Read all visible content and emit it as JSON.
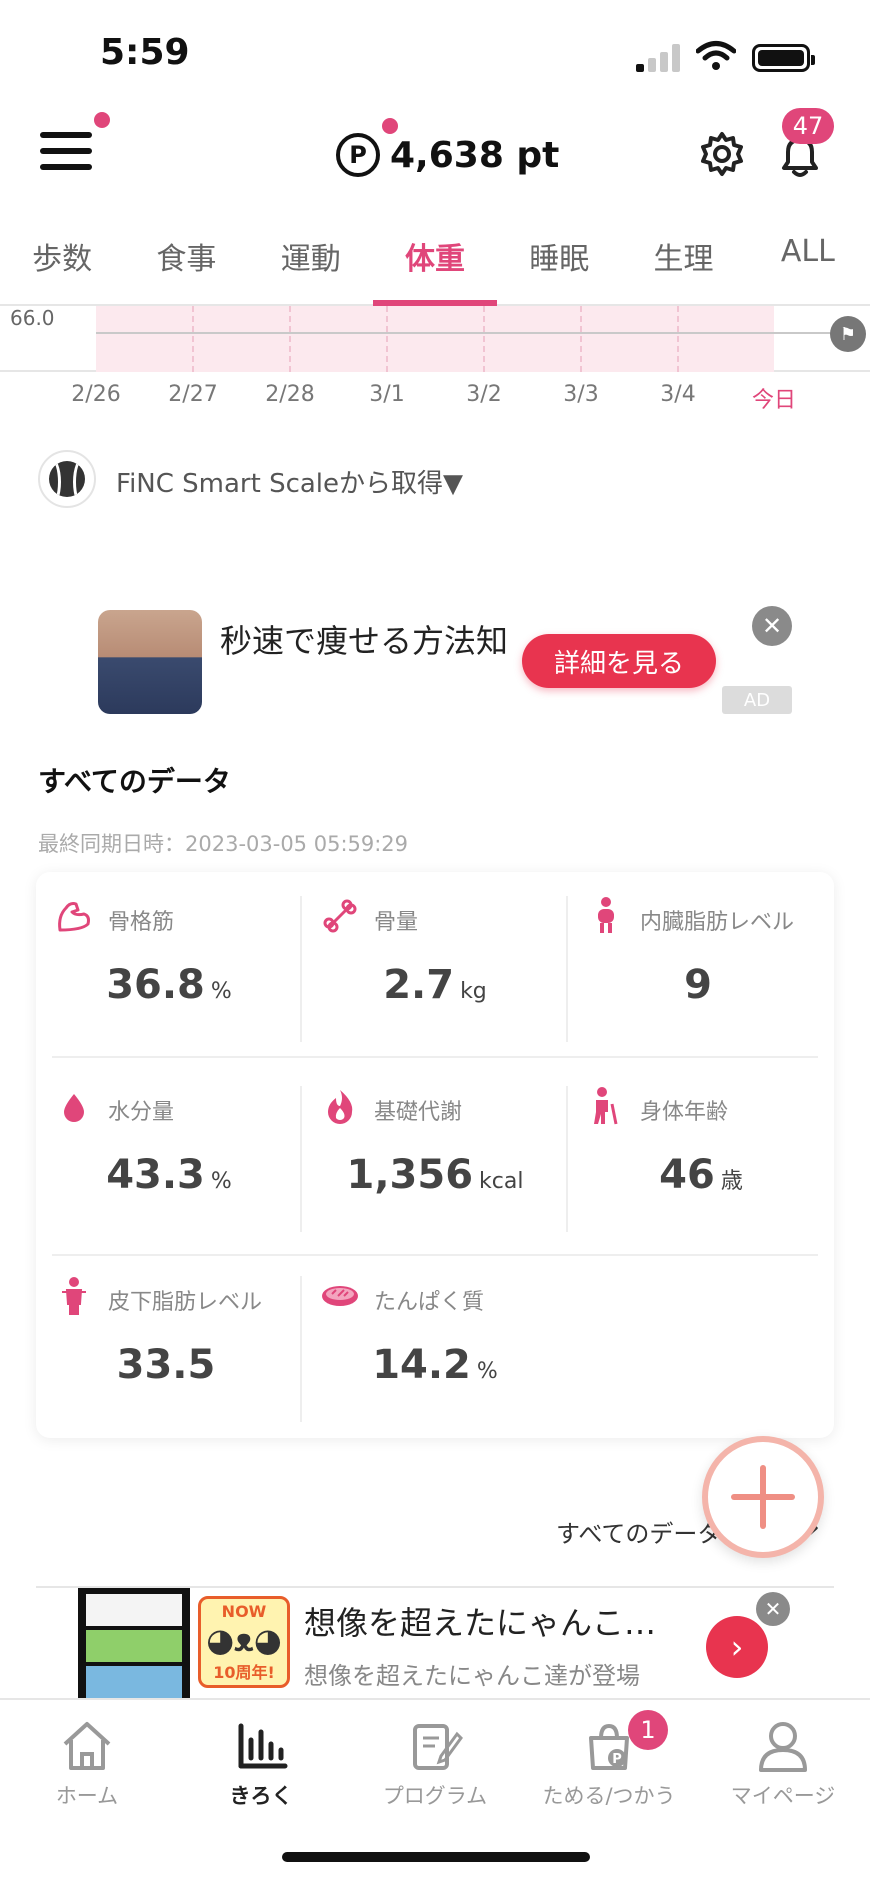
{
  "status_bar": {
    "time": "5:59"
  },
  "header": {
    "points": "4,638 pt",
    "points_symbol": "P",
    "notification_count": "47"
  },
  "tabs": [
    {
      "label": "歩数"
    },
    {
      "label": "食事"
    },
    {
      "label": "運動"
    },
    {
      "label": "体重",
      "active": true
    },
    {
      "label": "睡眠"
    },
    {
      "label": "生理"
    },
    {
      "label": "ALL"
    }
  ],
  "chart": {
    "y_label": "66.0",
    "x_labels": [
      "2/26",
      "2/27",
      "2/28",
      "3/1",
      "3/2",
      "3/3",
      "3/4",
      "今日"
    ]
  },
  "source": {
    "text": "FiNC Smart Scaleから取得▼"
  },
  "ad1": {
    "title": "秒速で痩せる方法知",
    "button": "詳細を見る",
    "badge": "AD"
  },
  "all_data": {
    "title": "すべてのデータ",
    "sync": "最終同期日時：2023-03-05 05:59:29",
    "metrics": [
      {
        "label": "骨格筋",
        "value": "36.8",
        "unit": "%",
        "icon": "muscle-icon"
      },
      {
        "label": "骨量",
        "value": "2.7",
        "unit": "kg",
        "icon": "bone-icon"
      },
      {
        "label": "内臓脂肪レベル",
        "value": "9",
        "unit": "",
        "icon": "visceral-fat-icon"
      },
      {
        "label": "水分量",
        "value": "43.3",
        "unit": "%",
        "icon": "water-drop-icon"
      },
      {
        "label": "基礎代謝",
        "value": "1,356",
        "unit": "kcal",
        "icon": "flame-icon"
      },
      {
        "label": "身体年齢",
        "value": "46",
        "unit": "歳",
        "icon": "body-age-icon"
      },
      {
        "label": "皮下脂肪レベル",
        "value": "33.5",
        "unit": "",
        "icon": "subcutaneous-fat-icon"
      },
      {
        "label": "たんぱく質",
        "value": "14.2",
        "unit": "%",
        "icon": "meat-icon"
      }
    ],
    "link": "すべてのデータ",
    "link_chevron": "›"
  },
  "ad2": {
    "title": "想像を超えたにゃんこ…",
    "subtitle": "想像を超えたにゃんこ達が登場",
    "logo_top": "NOW",
    "logo_bottom": "10周年!"
  },
  "bottom_nav": [
    {
      "label": "ホーム",
      "icon": "home-icon"
    },
    {
      "label": "きろく",
      "icon": "chart-icon",
      "active": true
    },
    {
      "label": "プログラム",
      "icon": "program-icon"
    },
    {
      "label": "ためる/つかう",
      "icon": "points-bag-icon",
      "badge": "1"
    },
    {
      "label": "マイページ",
      "icon": "person-icon"
    }
  ],
  "colors": {
    "accent": "#e0467a",
    "ad_button": "#e8344f",
    "fab_ring": "#f4b4aa"
  }
}
